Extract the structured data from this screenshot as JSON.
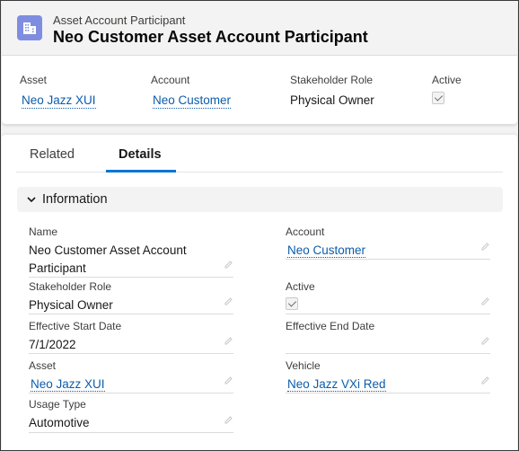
{
  "header": {
    "object_type": "Asset Account Participant",
    "title": "Neo Customer Asset Account Participant"
  },
  "highlights": [
    {
      "label": "Asset",
      "value": "Neo Jazz XUI",
      "type": "link"
    },
    {
      "label": "Account",
      "value": "Neo Customer",
      "type": "link"
    },
    {
      "label": "Stakeholder Role",
      "value": "Physical Owner",
      "type": "text"
    },
    {
      "label": "Active",
      "value": true,
      "type": "checkbox"
    }
  ],
  "tabs": [
    {
      "label": "Related",
      "active": false
    },
    {
      "label": "Details",
      "active": true
    }
  ],
  "section": {
    "title": "Information",
    "expanded": true
  },
  "fields": {
    "name": {
      "label": "Name",
      "value": "Neo Customer Asset Account Participant"
    },
    "account": {
      "label": "Account",
      "value": "Neo Customer"
    },
    "stakeholder_role": {
      "label": "Stakeholder Role",
      "value": "Physical Owner"
    },
    "active": {
      "label": "Active",
      "value": true
    },
    "effective_start_date": {
      "label": "Effective Start Date",
      "value": "7/1/2022"
    },
    "effective_end_date": {
      "label": "Effective End Date",
      "value": ""
    },
    "asset": {
      "label": "Asset",
      "value": "Neo Jazz XUI"
    },
    "vehicle": {
      "label": "Vehicle",
      "value": "Neo Jazz VXi Red"
    },
    "usage_type": {
      "label": "Usage Type",
      "value": "Automotive"
    }
  },
  "colors": {
    "link": "#0b5cab",
    "tab_active_underline": "#0176d3",
    "object_icon_bg": "#7f8de1"
  }
}
